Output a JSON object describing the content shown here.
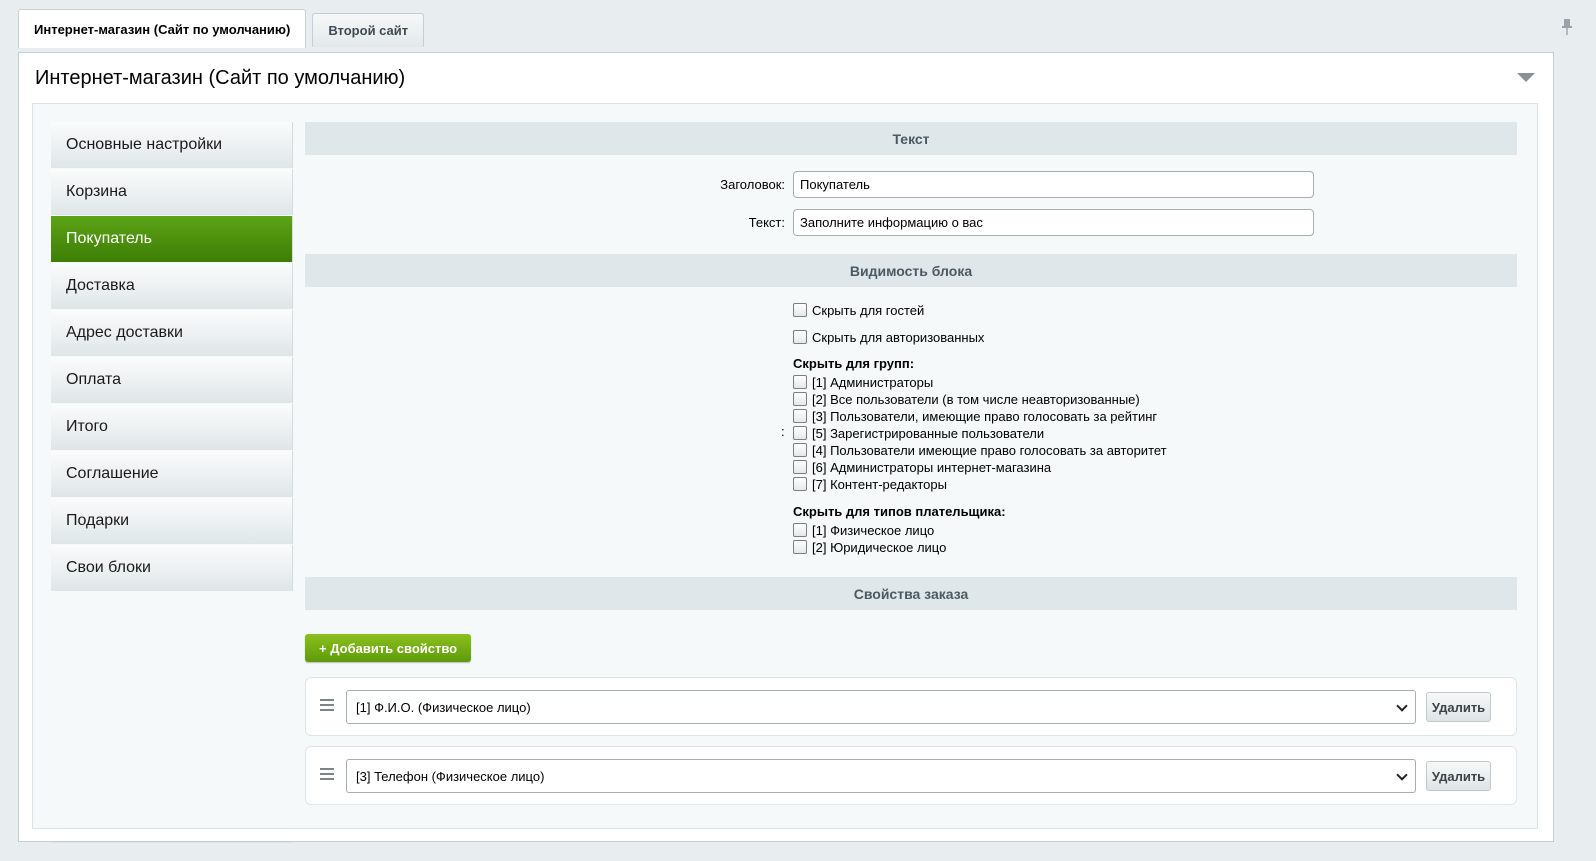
{
  "tabs": [
    {
      "label": "Интернет-магазин (Сайт по умолчанию)",
      "active": true
    },
    {
      "label": "Второй сайт",
      "active": false
    }
  ],
  "panel": {
    "title": "Интернет-магазин (Сайт по умолчанию)"
  },
  "sidebar": {
    "items": [
      {
        "label": "Основные настройки"
      },
      {
        "label": "Корзина"
      },
      {
        "label": "Покупатель",
        "active": true
      },
      {
        "label": "Доставка"
      },
      {
        "label": "Адрес доставки"
      },
      {
        "label": "Оплата"
      },
      {
        "label": "Итого"
      },
      {
        "label": "Соглашение"
      },
      {
        "label": "Подарки"
      },
      {
        "label": "Свои блоки"
      }
    ]
  },
  "text_section": {
    "heading": "Текст",
    "title_label": "Заголовок:",
    "title_value": "Покупатель",
    "text_label": "Текст:",
    "text_value": "Заполните информацию о вас"
  },
  "visibility_section": {
    "heading": "Видимость блока",
    "hide_guests": "Скрыть для гостей",
    "hide_authorized": "Скрыть для авторизованных",
    "groups_title": "Скрыть для групп:",
    "colon": ":",
    "groups": [
      "[1] Администраторы",
      "[2] Все пользователи (в том числе неавторизованные)",
      "[3] Пользователи, имеющие право голосовать за рейтинг",
      "[5] Зарегистрированные пользователи",
      "[4] Пользователи имеющие право голосовать за авторитет",
      "[6] Администраторы интернет-магазина",
      "[7] Контент-редакторы"
    ],
    "payer_types_title": "Скрыть для типов плательщика:",
    "payer_types": [
      "[1] Физическое лицо",
      "[2] Юридическое лицо"
    ]
  },
  "order_props_section": {
    "heading": "Свойства заказа",
    "add_button": "+ Добавить свойство",
    "properties": [
      {
        "value": "[1] Ф.И.О. (Физическое лицо)",
        "delete_label": "Удалить"
      },
      {
        "value": "[3] Телефон (Физическое лицо)",
        "delete_label": "Удалить"
      }
    ]
  },
  "colors": {
    "active_green": "#4a8f0c",
    "section_bg": "#e0e7ea"
  }
}
